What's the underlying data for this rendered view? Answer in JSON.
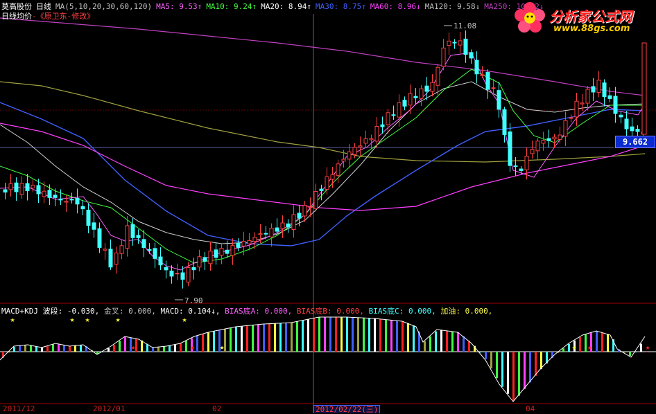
{
  "header": {
    "stock": "莫高股份",
    "period": "日线",
    "ma_params": "MA(5,10,20,30,60,120)",
    "ma5": "MA5: 9.53↑",
    "ma10": "MA10: 9.24↑",
    "ma20": "MA20: 8.94↑",
    "ma30": "MA30: 8.75↑",
    "ma60": "MA60: 8.96↓",
    "ma120": "MA120: 9.58↓",
    "ma250": "MA250: 10.62↓"
  },
  "subheader": {
    "label": "日线均价",
    "note": "-《原卫东-修改》"
  },
  "logo": {
    "name": "分析家公式网",
    "url": "www.88gs.com"
  },
  "price": {
    "current": "9.662",
    "high_label": "11.08",
    "low_label": "7.90"
  },
  "indicator": {
    "title": "MACD+KDJ",
    "wave": "波段: -0.030,",
    "golden_cross": "金叉: 0.000,",
    "macd": "MACD: 0.104↓,",
    "bias_a": "BIAS底A: 0.000,",
    "bias_b": "BIAS底B: 0.000,",
    "bias_c": "BIAS底C: 0.000,",
    "add_oil": "加油: 0.000,"
  },
  "dates": [
    "2011/12",
    "2012/01",
    "02",
    "04"
  ],
  "selected_date": "2012/02/22(三)",
  "colors": {
    "up": "#ff4040",
    "down": "#40ffff",
    "ma5": "#ffffff",
    "ma10": "#ffff40",
    "ma20": "#ff40ff",
    "ma30": "#40ff40",
    "ma60": "#4060ff",
    "ma120": "#a0a040",
    "ma250": "#c040c0"
  }
}
